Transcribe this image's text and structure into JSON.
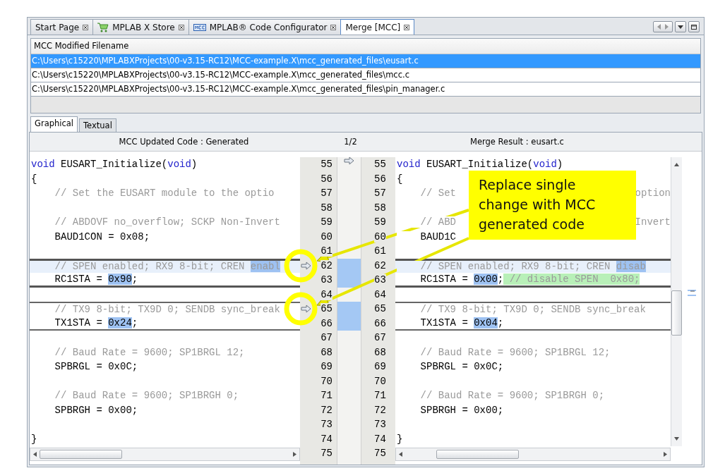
{
  "tabs": [
    {
      "label": "Start Page",
      "selected": false
    },
    {
      "label": "MPLAB X Store",
      "selected": false
    },
    {
      "label": "MPLAB® Code Configurator",
      "selected": false
    },
    {
      "label": "Merge [MCC]",
      "selected": true
    }
  ],
  "file_table": {
    "columns": [
      "MCC Modified Filename"
    ],
    "rows": [
      {
        "path": "C:\\Users\\c15220\\MPLABXProjects\\00-v3.15-RC12\\MCC-example.X\\mcc_generated_files\\eusart.c",
        "selected": true
      },
      {
        "path": "C:\\Users\\c15220\\MPLABXProjects\\00-v3.15-RC12\\MCC-example.X\\mcc_generated_files\\mcc.c",
        "selected": false
      },
      {
        "path": "C:\\Users\\c15220\\MPLABXProjects\\00-v3.15-RC12\\MCC-example.X\\mcc_generated_files\\pin_manager.c",
        "selected": false
      }
    ]
  },
  "view_tabs": [
    {
      "label": "Graphical",
      "selected": true
    },
    {
      "label": "Textual",
      "selected": false
    }
  ],
  "diff": {
    "left_title": "MCC Updated Code : Generated",
    "counter": "1/2",
    "right_title": "Merge Result : eusart.c",
    "lines": [
      {
        "left_number": "55",
        "right_number": "55",
        "changed": false,
        "tinted": false,
        "left": [
          {
            "text": "void",
            "kind": "keyword"
          },
          {
            "text": " EUSART_Initialize(",
            "kind": "plain"
          },
          {
            "text": "void",
            "kind": "keyword"
          },
          {
            "text": ")",
            "kind": "plain"
          }
        ],
        "right": [
          {
            "text": "void",
            "kind": "keyword"
          },
          {
            "text": " EUSART_Initialize(",
            "kind": "plain"
          },
          {
            "text": "void",
            "kind": "keyword"
          },
          {
            "text": ")",
            "kind": "plain"
          }
        ]
      },
      {
        "left_number": "56",
        "right_number": "56",
        "changed": false,
        "tinted": false,
        "left": [
          {
            "text": "{",
            "kind": "plain"
          }
        ],
        "right": [
          {
            "text": "{",
            "kind": "plain"
          }
        ]
      },
      {
        "left_number": "57",
        "right_number": "57",
        "changed": false,
        "tinted": false,
        "left": [
          {
            "text": "    // Set the EUSART module to the optio",
            "kind": "comment"
          }
        ],
        "right": [
          {
            "text": "    // Set",
            "kind": "comment"
          }
        ],
        "right_tail": {
          "text": "option",
          "kind": "comment"
        }
      },
      {
        "left_number": "58",
        "right_number": "58",
        "changed": false,
        "tinted": false
      },
      {
        "left_number": "59",
        "right_number": "59",
        "changed": false,
        "tinted": false,
        "left": [
          {
            "text": "    // ABDOVF no_overflow; SCKP Non-Invert",
            "kind": "comment"
          }
        ],
        "right": [
          {
            "text": "    // ABD",
            "kind": "comment"
          }
        ],
        "right_tail": {
          "text": "Invert",
          "kind": "comment"
        }
      },
      {
        "left_number": "60",
        "right_number": "60",
        "changed": false,
        "tinted": false,
        "left": [
          {
            "text": "    BAUD1CON = 0x08;",
            "kind": "plain"
          }
        ],
        "right": [
          {
            "text": "    BAUD1C",
            "kind": "plain"
          }
        ]
      },
      {
        "left_number": "61",
        "right_number": "61",
        "changed": false,
        "tinted": false
      },
      {
        "left_number": "62",
        "right_number": "62",
        "changed": true,
        "current": true,
        "tinted": true,
        "merge_arrow": true,
        "left": [
          {
            "text": "    // SPEN enabled; RX9 8-bit; CREN ",
            "kind": "comment"
          },
          {
            "text": "enabl",
            "kind": "comment",
            "highlight": true
          }
        ],
        "right": [
          {
            "text": "    // SPEN enabled; RX9 8-bit; CREN ",
            "kind": "comment"
          },
          {
            "text": "disab",
            "kind": "comment",
            "highlight": true
          }
        ]
      },
      {
        "left_number": "63",
        "right_number": "63",
        "changed": true,
        "current": true,
        "tinted": false,
        "left": [
          {
            "text": "    RC1STA = ",
            "kind": "plain"
          },
          {
            "text": "0x90",
            "kind": "plain",
            "highlight": true
          },
          {
            "text": ";",
            "kind": "plain"
          }
        ],
        "right": [
          {
            "text": "    RC1STA = ",
            "kind": "plain"
          },
          {
            "text": "0x00",
            "kind": "plain",
            "highlight": true
          },
          {
            "text": ";",
            "kind": "plain"
          },
          {
            "text": " // disable SPEN  0x80;",
            "kind": "added"
          }
        ]
      },
      {
        "left_number": "64",
        "right_number": "64",
        "changed": false,
        "tinted": false
      },
      {
        "left_number": "65",
        "right_number": "65",
        "changed": true,
        "current": false,
        "tinted": false,
        "merge_arrow": true,
        "left": [
          {
            "text": "    // TX9 8-bit; TX9D 0; SENDB sync_break",
            "kind": "comment"
          }
        ],
        "right": [
          {
            "text": "    // TX9 8-bit; TX9D 0; SENDB sync_break",
            "kind": "comment"
          }
        ]
      },
      {
        "left_number": "66",
        "right_number": "66",
        "changed": true,
        "current": false,
        "tinted": false,
        "left": [
          {
            "text": "    TX1STA = ",
            "kind": "plain"
          },
          {
            "text": "0x24",
            "kind": "plain",
            "highlight": true
          },
          {
            "text": ";",
            "kind": "plain"
          }
        ],
        "right": [
          {
            "text": "    TX1STA = ",
            "kind": "plain"
          },
          {
            "text": "0x04",
            "kind": "plain",
            "highlight": true
          },
          {
            "text": ";",
            "kind": "plain"
          }
        ]
      },
      {
        "left_number": "67",
        "right_number": "67",
        "changed": false,
        "tinted": false
      },
      {
        "left_number": "68",
        "right_number": "68",
        "changed": false,
        "tinted": false,
        "left": [
          {
            "text": "    // Baud Rate = 9600; SP1BRGL 12;",
            "kind": "comment"
          }
        ],
        "right": [
          {
            "text": "    // Baud Rate = 9600; SP1BRGL 12;",
            "kind": "comment"
          }
        ]
      },
      {
        "left_number": "69",
        "right_number": "69",
        "changed": false,
        "tinted": false,
        "left": [
          {
            "text": "    SPBRGL = 0x0C;",
            "kind": "plain"
          }
        ],
        "right": [
          {
            "text": "    SPBRGL = 0x0C;",
            "kind": "plain"
          }
        ]
      },
      {
        "left_number": "70",
        "right_number": "70",
        "changed": false,
        "tinted": false
      },
      {
        "left_number": "71",
        "right_number": "71",
        "changed": false,
        "tinted": false,
        "left": [
          {
            "text": "    // Baud Rate = 9600; SP1BRGH 0;",
            "kind": "comment"
          }
        ],
        "right": [
          {
            "text": "    // Baud Rate = 9600; SP1BRGH 0;",
            "kind": "comment"
          }
        ]
      },
      {
        "left_number": "72",
        "right_number": "72",
        "changed": false,
        "tinted": false,
        "left": [
          {
            "text": "    SPBRGH = 0x00;",
            "kind": "plain"
          }
        ],
        "right": [
          {
            "text": "    SPBRGH = 0x00;",
            "kind": "plain"
          }
        ]
      },
      {
        "left_number": "73",
        "right_number": "73",
        "changed": false,
        "tinted": false
      },
      {
        "left_number": "74",
        "right_number": "74",
        "changed": false,
        "tinted": false,
        "left": [
          {
            "text": "}",
            "kind": "plain"
          }
        ],
        "right": [
          {
            "text": "}",
            "kind": "plain"
          }
        ]
      }
    ],
    "last_line": {
      "left_number": "75",
      "right_number": "75"
    }
  },
  "callout": {
    "text": "Replace single change with MCC generated code"
  }
}
